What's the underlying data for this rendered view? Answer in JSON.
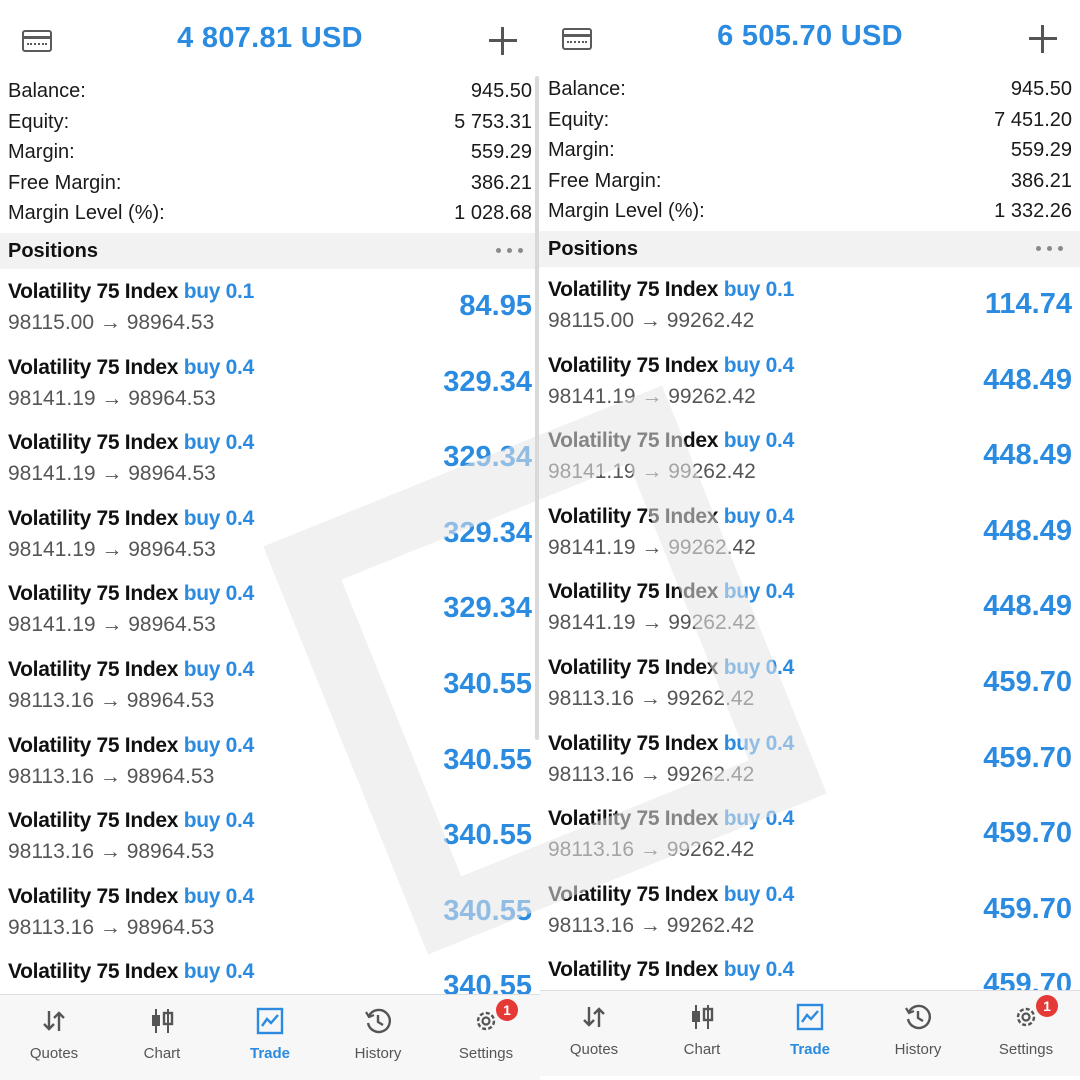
{
  "nav_labels": [
    "Quotes",
    "Chart",
    "Trade",
    "History",
    "Settings"
  ],
  "settings_badge": "1",
  "colors": {
    "accent": "#2a8be0",
    "badge": "#e53935"
  },
  "positions_title": "Positions",
  "summary_labels": [
    "Balance:",
    "Equity:",
    "Margin:",
    "Free Margin:",
    "Margin Level (%):"
  ],
  "panes": [
    {
      "header_title": "4 807.81 USD",
      "summary_values": [
        "945.50",
        "5 753.31",
        "559.29",
        "386.21",
        "1 028.68"
      ],
      "positions": [
        {
          "symbol": "Volatility 75 Index",
          "side": "buy 0.1",
          "prices": "98115.00 → 98964.53",
          "profit": "84.95"
        },
        {
          "symbol": "Volatility 75 Index",
          "side": "buy 0.4",
          "prices": "98141.19 → 98964.53",
          "profit": "329.34"
        },
        {
          "symbol": "Volatility 75 Index",
          "side": "buy 0.4",
          "prices": "98141.19 → 98964.53",
          "profit": "329.34"
        },
        {
          "symbol": "Volatility 75 Index",
          "side": "buy 0.4",
          "prices": "98141.19 → 98964.53",
          "profit": "329.34"
        },
        {
          "symbol": "Volatility 75 Index",
          "side": "buy 0.4",
          "prices": "98141.19 → 98964.53",
          "profit": "329.34"
        },
        {
          "symbol": "Volatility 75 Index",
          "side": "buy 0.4",
          "prices": "98113.16 → 98964.53",
          "profit": "340.55"
        },
        {
          "symbol": "Volatility 75 Index",
          "side": "buy 0.4",
          "prices": "98113.16 → 98964.53",
          "profit": "340.55"
        },
        {
          "symbol": "Volatility 75 Index",
          "side": "buy 0.4",
          "prices": "98113.16 → 98964.53",
          "profit": "340.55"
        },
        {
          "symbol": "Volatility 75 Index",
          "side": "buy 0.4",
          "prices": "98113.16 → 98964.53",
          "profit": "340.55"
        },
        {
          "symbol": "Volatility 75 Index",
          "side": "buy 0.4",
          "prices": "",
          "profit": "340.55"
        }
      ]
    },
    {
      "header_title": "6 505.70 USD",
      "summary_values": [
        "945.50",
        "7 451.20",
        "559.29",
        "386.21",
        "1 332.26"
      ],
      "positions": [
        {
          "symbol": "Volatility 75 Index",
          "side": "buy 0.1",
          "prices": "98115.00 → 99262.42",
          "profit": "114.74"
        },
        {
          "symbol": "Volatility 75 Index",
          "side": "buy 0.4",
          "prices": "98141.19 → 99262.42",
          "profit": "448.49"
        },
        {
          "symbol": "Volatility 75 Index",
          "side": "buy 0.4",
          "prices": "98141.19 → 99262.42",
          "profit": "448.49"
        },
        {
          "symbol": "Volatility 75 Index",
          "side": "buy 0.4",
          "prices": "98141.19 → 99262.42",
          "profit": "448.49"
        },
        {
          "symbol": "Volatility 75 Index",
          "side": "buy 0.4",
          "prices": "98141.19 → 99262.42",
          "profit": "448.49"
        },
        {
          "symbol": "Volatility 75 Index",
          "side": "buy 0.4",
          "prices": "98113.16 → 99262.42",
          "profit": "459.70"
        },
        {
          "symbol": "Volatility 75 Index",
          "side": "buy 0.4",
          "prices": "98113.16 → 99262.42",
          "profit": "459.70"
        },
        {
          "symbol": "Volatility 75 Index",
          "side": "buy 0.4",
          "prices": "98113.16 → 99262.42",
          "profit": "459.70"
        },
        {
          "symbol": "Volatility 75 Index",
          "side": "buy 0.4",
          "prices": "98113.16 → 99262.42",
          "profit": "459.70"
        },
        {
          "symbol": "Volatility 75 Index",
          "side": "buy 0.4",
          "prices": "",
          "profit": "459.70"
        }
      ]
    }
  ]
}
